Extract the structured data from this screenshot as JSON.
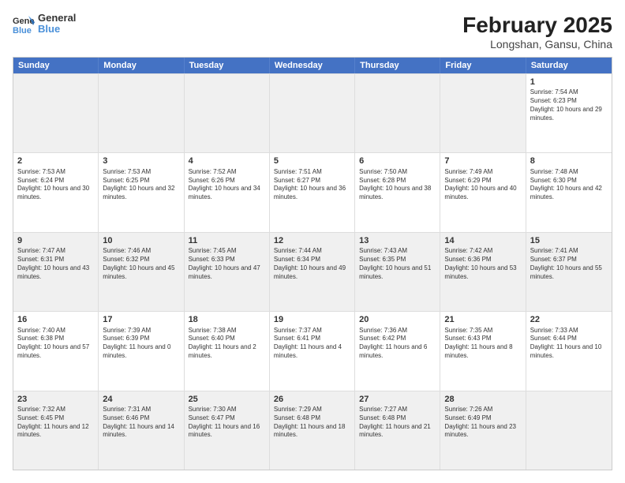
{
  "header": {
    "logo_general": "General",
    "logo_blue": "Blue",
    "main_title": "February 2025",
    "sub_title": "Longshan, Gansu, China"
  },
  "days_of_week": [
    "Sunday",
    "Monday",
    "Tuesday",
    "Wednesday",
    "Thursday",
    "Friday",
    "Saturday"
  ],
  "rows": [
    [
      {
        "day": "",
        "info": "",
        "shaded": true
      },
      {
        "day": "",
        "info": "",
        "shaded": true
      },
      {
        "day": "",
        "info": "",
        "shaded": true
      },
      {
        "day": "",
        "info": "",
        "shaded": true
      },
      {
        "day": "",
        "info": "",
        "shaded": true
      },
      {
        "day": "",
        "info": "",
        "shaded": true
      },
      {
        "day": "1",
        "info": "Sunrise: 7:54 AM\nSunset: 6:23 PM\nDaylight: 10 hours and 29 minutes."
      }
    ],
    [
      {
        "day": "2",
        "info": "Sunrise: 7:53 AM\nSunset: 6:24 PM\nDaylight: 10 hours and 30 minutes."
      },
      {
        "day": "3",
        "info": "Sunrise: 7:53 AM\nSunset: 6:25 PM\nDaylight: 10 hours and 32 minutes."
      },
      {
        "day": "4",
        "info": "Sunrise: 7:52 AM\nSunset: 6:26 PM\nDaylight: 10 hours and 34 minutes."
      },
      {
        "day": "5",
        "info": "Sunrise: 7:51 AM\nSunset: 6:27 PM\nDaylight: 10 hours and 36 minutes."
      },
      {
        "day": "6",
        "info": "Sunrise: 7:50 AM\nSunset: 6:28 PM\nDaylight: 10 hours and 38 minutes."
      },
      {
        "day": "7",
        "info": "Sunrise: 7:49 AM\nSunset: 6:29 PM\nDaylight: 10 hours and 40 minutes."
      },
      {
        "day": "8",
        "info": "Sunrise: 7:48 AM\nSunset: 6:30 PM\nDaylight: 10 hours and 42 minutes."
      }
    ],
    [
      {
        "day": "9",
        "info": "Sunrise: 7:47 AM\nSunset: 6:31 PM\nDaylight: 10 hours and 43 minutes.",
        "shaded": true
      },
      {
        "day": "10",
        "info": "Sunrise: 7:46 AM\nSunset: 6:32 PM\nDaylight: 10 hours and 45 minutes.",
        "shaded": true
      },
      {
        "day": "11",
        "info": "Sunrise: 7:45 AM\nSunset: 6:33 PM\nDaylight: 10 hours and 47 minutes.",
        "shaded": true
      },
      {
        "day": "12",
        "info": "Sunrise: 7:44 AM\nSunset: 6:34 PM\nDaylight: 10 hours and 49 minutes.",
        "shaded": true
      },
      {
        "day": "13",
        "info": "Sunrise: 7:43 AM\nSunset: 6:35 PM\nDaylight: 10 hours and 51 minutes.",
        "shaded": true
      },
      {
        "day": "14",
        "info": "Sunrise: 7:42 AM\nSunset: 6:36 PM\nDaylight: 10 hours and 53 minutes.",
        "shaded": true
      },
      {
        "day": "15",
        "info": "Sunrise: 7:41 AM\nSunset: 6:37 PM\nDaylight: 10 hours and 55 minutes.",
        "shaded": true
      }
    ],
    [
      {
        "day": "16",
        "info": "Sunrise: 7:40 AM\nSunset: 6:38 PM\nDaylight: 10 hours and 57 minutes."
      },
      {
        "day": "17",
        "info": "Sunrise: 7:39 AM\nSunset: 6:39 PM\nDaylight: 11 hours and 0 minutes."
      },
      {
        "day": "18",
        "info": "Sunrise: 7:38 AM\nSunset: 6:40 PM\nDaylight: 11 hours and 2 minutes."
      },
      {
        "day": "19",
        "info": "Sunrise: 7:37 AM\nSunset: 6:41 PM\nDaylight: 11 hours and 4 minutes."
      },
      {
        "day": "20",
        "info": "Sunrise: 7:36 AM\nSunset: 6:42 PM\nDaylight: 11 hours and 6 minutes."
      },
      {
        "day": "21",
        "info": "Sunrise: 7:35 AM\nSunset: 6:43 PM\nDaylight: 11 hours and 8 minutes."
      },
      {
        "day": "22",
        "info": "Sunrise: 7:33 AM\nSunset: 6:44 PM\nDaylight: 11 hours and 10 minutes."
      }
    ],
    [
      {
        "day": "23",
        "info": "Sunrise: 7:32 AM\nSunset: 6:45 PM\nDaylight: 11 hours and 12 minutes.",
        "shaded": true
      },
      {
        "day": "24",
        "info": "Sunrise: 7:31 AM\nSunset: 6:46 PM\nDaylight: 11 hours and 14 minutes.",
        "shaded": true
      },
      {
        "day": "25",
        "info": "Sunrise: 7:30 AM\nSunset: 6:47 PM\nDaylight: 11 hours and 16 minutes.",
        "shaded": true
      },
      {
        "day": "26",
        "info": "Sunrise: 7:29 AM\nSunset: 6:48 PM\nDaylight: 11 hours and 18 minutes.",
        "shaded": true
      },
      {
        "day": "27",
        "info": "Sunrise: 7:27 AM\nSunset: 6:48 PM\nDaylight: 11 hours and 21 minutes.",
        "shaded": true
      },
      {
        "day": "28",
        "info": "Sunrise: 7:26 AM\nSunset: 6:49 PM\nDaylight: 11 hours and 23 minutes.",
        "shaded": true
      },
      {
        "day": "",
        "info": "",
        "shaded": true
      }
    ]
  ]
}
